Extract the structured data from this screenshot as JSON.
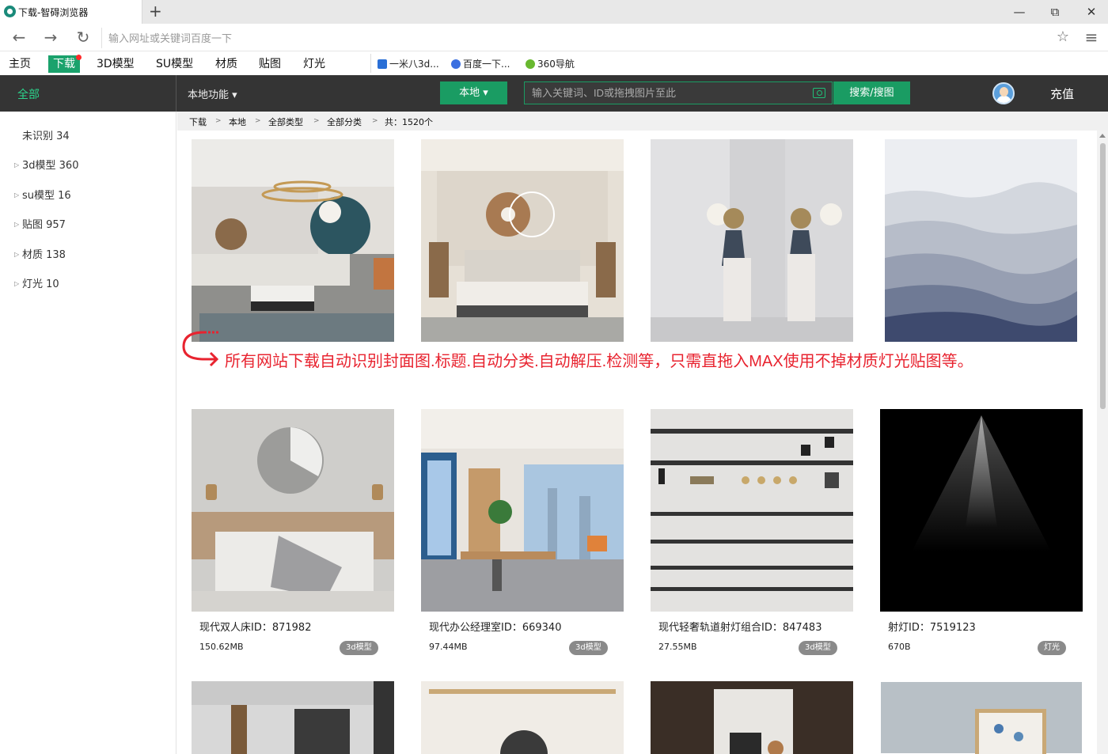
{
  "browser": {
    "tab_title": "下载-智碍浏览器",
    "new_tab": "+",
    "address_placeholder": "输入网址或关键词百度一下"
  },
  "window_controls": {
    "minimize": "—",
    "restore": "⧉",
    "close": "✕"
  },
  "nav_icons": {
    "back": "←",
    "forward": "→",
    "reload": "↻",
    "star": "☆",
    "menu": "≡"
  },
  "bookmarks": [
    {
      "label": "主页"
    },
    {
      "label": "下载",
      "active": true
    },
    {
      "label": "3D模型"
    },
    {
      "label": "SU模型"
    },
    {
      "label": "材质"
    },
    {
      "label": "贴图"
    },
    {
      "label": "灯光"
    }
  ],
  "quick_links": [
    {
      "label": "一米八3d...",
      "icon": "yimi-icon",
      "color": "#2a6fd6"
    },
    {
      "label": "百度一下...",
      "icon": "baidu-icon",
      "color": "#3b6fe0"
    },
    {
      "label": "360导航",
      "icon": "360-icon",
      "color": "#68b82f"
    }
  ],
  "toolbar": {
    "all_label": "全部",
    "local_functions": "本地功能 ▾",
    "local_dropdown": "本地 ▾",
    "search_placeholder": "输入关键词、ID或拖拽图片至此",
    "search_button": "搜索/搜图",
    "recharge": "充值"
  },
  "sidebar": {
    "items": [
      {
        "label": "未识别 34",
        "expandable": false
      },
      {
        "label": "3d模型 360",
        "expandable": true
      },
      {
        "label": "su模型 16",
        "expandable": true
      },
      {
        "label": "贴图 957",
        "expandable": true
      },
      {
        "label": "材质 138",
        "expandable": true
      },
      {
        "label": "灯光 10",
        "expandable": true
      }
    ]
  },
  "breadcrumb": {
    "items": [
      "下载",
      "本地",
      "全部类型",
      "全部分类",
      "共：1520个"
    ],
    "separator": ">"
  },
  "promo_text": "所有网站下载自动识别封面图.标题.自动分类.自动解压.检测等，只需直拖入MAX使用不掉材质灯光贴图等。",
  "items_row2": [
    {
      "title": "现代双人床ID：871982",
      "size": "150.62MB",
      "tag": "3d模型"
    },
    {
      "title": "现代办公经理室ID：669340",
      "size": "97.44MB",
      "tag": "3d模型"
    },
    {
      "title": "现代轻奢轨道射灯组合ID：847483",
      "size": "27.55MB",
      "tag": "3d模型"
    },
    {
      "title": "射灯ID：7519123",
      "size": "670B",
      "tag": "灯光"
    }
  ]
}
